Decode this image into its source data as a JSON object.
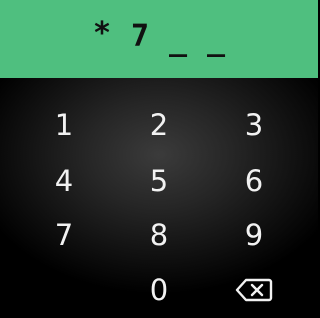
{
  "pin": {
    "chars": [
      "*",
      "7",
      "_",
      "_"
    ]
  },
  "keypad": {
    "keys": [
      "1",
      "2",
      "3",
      "4",
      "5",
      "6",
      "7",
      "8",
      "9",
      "0"
    ],
    "backspace_icon": "backspace-icon"
  },
  "colors": {
    "pin_bar": "#4fbf7f",
    "key_text": "#f2f2f2",
    "background": "#000000"
  }
}
